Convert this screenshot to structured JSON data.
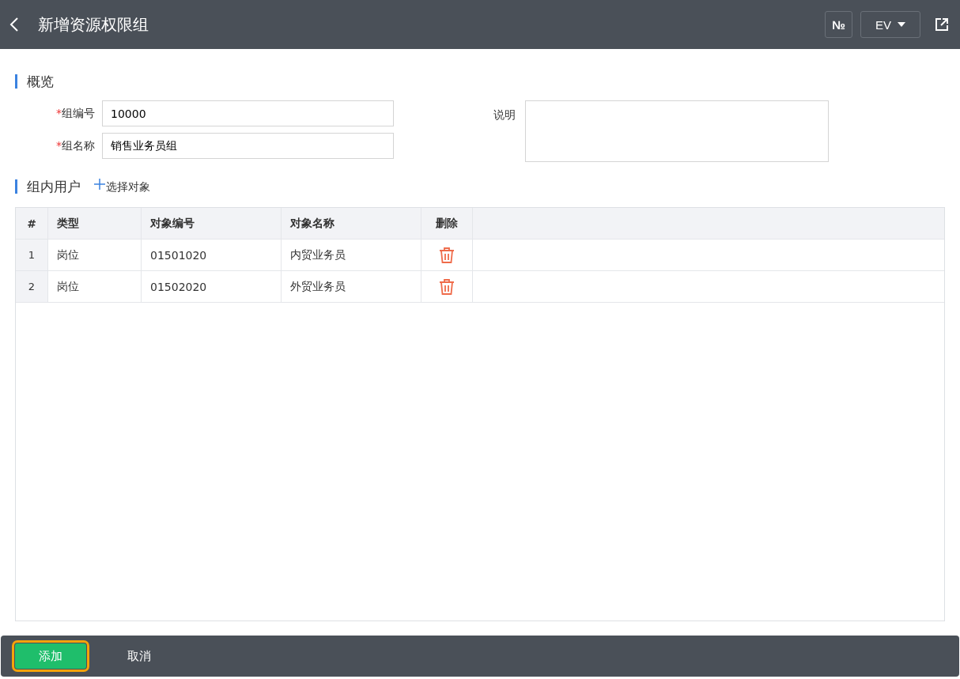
{
  "header": {
    "title": "新增资源权限组",
    "number_button": "№",
    "language": "EV"
  },
  "overview": {
    "title": "概览",
    "fields": [
      {
        "required_mark": "*",
        "label": "组编号",
        "value": "10000"
      },
      {
        "required_mark": "*",
        "label": "组名称",
        "value": "销售业务员组"
      }
    ],
    "description": {
      "label": "说明"
    }
  },
  "users": {
    "title": "组内用户",
    "select_link": "选择对象",
    "table": {
      "columns": [
        "#",
        "类型",
        "对象编号",
        "对象名称",
        "删除"
      ],
      "rows": [
        {
          "index": "1",
          "type": "岗位",
          "code": "01501020",
          "name": "内贸业务员"
        },
        {
          "index": "2",
          "type": "岗位",
          "code": "01502020",
          "name": "外贸业务员"
        }
      ]
    }
  },
  "footer": {
    "buttons": [
      {
        "label": "添加",
        "kind": "primary",
        "focused": true
      },
      {
        "label": "取消",
        "kind": "text",
        "focused": false
      }
    ]
  }
}
